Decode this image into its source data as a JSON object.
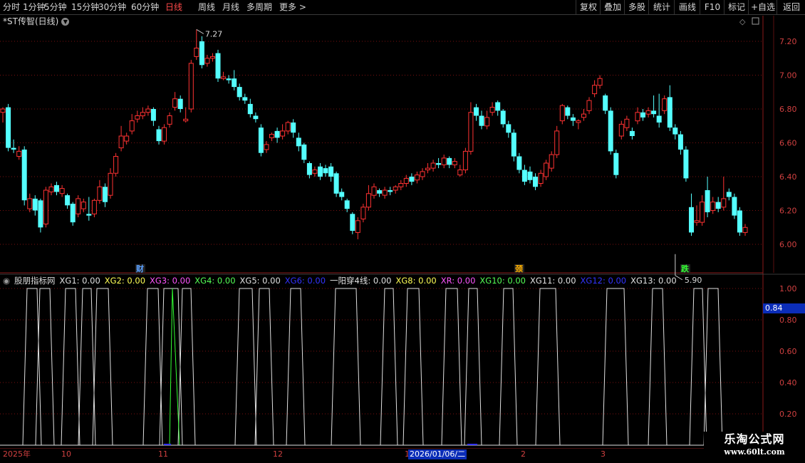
{
  "toolbar": {
    "periods": [
      "分时",
      "1分钟",
      "5分钟",
      "15分钟",
      "30分钟",
      "60分钟",
      "日线",
      "周线",
      "月线",
      "多周期",
      "更多 >"
    ],
    "active_period": "日线",
    "right_buttons": [
      "复权",
      "叠加",
      "多股",
      "统计",
      "画线",
      "F10",
      "标记",
      "+自选",
      "返回"
    ]
  },
  "chart": {
    "title": "*ST传智(日线)",
    "y_ticks": [
      "7.20",
      "7.00",
      "6.80",
      "6.60",
      "6.40",
      "6.20",
      "6.00"
    ],
    "high_label": "7.27",
    "low_label": "5.90",
    "events": [
      {
        "text": "财",
        "color": "#5aa0ff"
      },
      {
        "text": "颈",
        "color": "#ffb000"
      },
      {
        "text": "跌",
        "color": "#33ff33"
      }
    ]
  },
  "indicator": {
    "name": "股朋指标网",
    "lines": [
      {
        "text": "XG1: 0.00",
        "color": "#e0e0e0"
      },
      {
        "text": "XG2: 0.00",
        "color": "#ffff55"
      },
      {
        "text": "XG3: 0.00",
        "color": "#ff55ff"
      },
      {
        "text": "XG4: 0.00",
        "color": "#55ff55"
      },
      {
        "text": "XG5: 0.00",
        "color": "#e0e0e0"
      },
      {
        "text": "XG6: 0.00",
        "color": "#3333ff"
      },
      {
        "text": "一阳穿4线: 0.00",
        "color": "#e0e0e0"
      },
      {
        "text": "XG8: 0.00",
        "color": "#ffff55"
      },
      {
        "text": "XR: 0.00",
        "color": "#ff55ff"
      },
      {
        "text": "XG10: 0.00",
        "color": "#55ff55"
      },
      {
        "text": "XG11: 0.00",
        "color": "#e0e0e0"
      },
      {
        "text": "XG12: 0.00",
        "color": "#3333ff"
      },
      {
        "text": "XG13: 0.00",
        "color": "#e0e0e0"
      }
    ],
    "y_ticks": [
      "1.00",
      "0.80",
      "0.60",
      "0.40",
      "0.20"
    ],
    "cursor_value": "0.84"
  },
  "time_axis": {
    "labels": [
      "2025年",
      "10",
      "11",
      "12",
      "1",
      "2",
      "3"
    ],
    "selected_date": "2026/01/06/二"
  },
  "watermark": {
    "line1": "乐淘公式网",
    "line2": "www.60lt.com"
  },
  "colors": {
    "up": "#ff3232",
    "down": "#54ffff",
    "grid": "#7a1010",
    "axis_text": "#d04040",
    "active": "#ff4a4a"
  },
  "chart_data": {
    "type": "candlestick",
    "ylim": [
      5.82,
      7.35
    ],
    "candles": [
      [
        6.78,
        6.8,
        6.72,
        6.81
      ],
      [
        6.81,
        6.57,
        6.55,
        6.83
      ],
      [
        6.57,
        6.56,
        6.54,
        6.62
      ],
      [
        6.52,
        6.55,
        6.5,
        6.58
      ],
      [
        6.56,
        6.26,
        6.23,
        6.58
      ],
      [
        6.21,
        6.27,
        6.19,
        6.3
      ],
      [
        6.27,
        6.2,
        6.17,
        6.29
      ],
      [
        6.26,
        6.1,
        6.07,
        6.27
      ],
      [
        6.12,
        6.32,
        6.1,
        6.34
      ],
      [
        6.31,
        6.34,
        6.29,
        6.36
      ],
      [
        6.35,
        6.31,
        6.29,
        6.37
      ],
      [
        6.3,
        6.33,
        6.28,
        6.35
      ],
      [
        6.29,
        6.23,
        6.21,
        6.3
      ],
      [
        6.24,
        6.13,
        6.11,
        6.25
      ],
      [
        6.18,
        6.27,
        6.16,
        6.29
      ],
      [
        6.21,
        6.25,
        6.19,
        6.27
      ],
      [
        6.18,
        6.17,
        6.14,
        6.28
      ],
      [
        6.18,
        6.26,
        6.16,
        6.27
      ],
      [
        6.26,
        6.34,
        6.24,
        6.38
      ],
      [
        6.34,
        6.25,
        6.22,
        6.36
      ],
      [
        6.29,
        6.42,
        6.27,
        6.45
      ],
      [
        6.42,
        6.52,
        6.4,
        6.54
      ],
      [
        6.57,
        6.64,
        6.55,
        6.7
      ],
      [
        6.61,
        6.64,
        6.59,
        6.66
      ],
      [
        6.67,
        6.73,
        6.65,
        6.77
      ],
      [
        6.74,
        6.76,
        6.72,
        6.79
      ],
      [
        6.76,
        6.78,
        6.74,
        6.81
      ],
      [
        6.78,
        6.8,
        6.76,
        6.82
      ],
      [
        6.8,
        6.73,
        6.7,
        6.81
      ],
      [
        6.68,
        6.61,
        6.59,
        6.7
      ],
      [
        6.61,
        6.69,
        6.59,
        6.71
      ],
      [
        6.71,
        6.76,
        6.69,
        6.78
      ],
      [
        6.81,
        6.86,
        6.79,
        6.9
      ],
      [
        6.86,
        6.8,
        6.78,
        6.88
      ],
      [
        6.73,
        6.74,
        6.72,
        6.81
      ],
      [
        6.8,
        7.07,
        6.78,
        7.09
      ],
      [
        7.11,
        7.16,
        7.09,
        7.27
      ],
      [
        7.2,
        7.06,
        7.04,
        7.23
      ],
      [
        7.07,
        7.1,
        7.05,
        7.12
      ],
      [
        7.1,
        7.11,
        7.08,
        7.13
      ],
      [
        7.13,
        6.98,
        6.96,
        7.15
      ],
      [
        6.98,
        6.99,
        6.97,
        7.02
      ],
      [
        6.98,
        6.97,
        6.95,
        7.0
      ],
      [
        6.98,
        6.93,
        6.91,
        7.03
      ],
      [
        6.93,
        6.87,
        6.85,
        6.95
      ],
      [
        6.87,
        6.85,
        6.83,
        6.89
      ],
      [
        6.83,
        6.77,
        6.75,
        6.86
      ],
      [
        6.76,
        6.74,
        6.72,
        6.78
      ],
      [
        6.69,
        6.54,
        6.52,
        6.71
      ],
      [
        6.56,
        6.59,
        6.54,
        6.61
      ],
      [
        6.63,
        6.65,
        6.61,
        6.66
      ],
      [
        6.67,
        6.63,
        6.6,
        6.69
      ],
      [
        6.64,
        6.67,
        6.62,
        6.71
      ],
      [
        6.67,
        6.72,
        6.65,
        6.73
      ],
      [
        6.72,
        6.66,
        6.63,
        6.74
      ],
      [
        6.63,
        6.58,
        6.55,
        6.66
      ],
      [
        6.59,
        6.5,
        6.48,
        6.6
      ],
      [
        6.48,
        6.41,
        6.39,
        6.49
      ],
      [
        6.42,
        6.44,
        6.4,
        6.46
      ],
      [
        6.46,
        6.4,
        6.38,
        6.48
      ],
      [
        6.45,
        6.42,
        6.4,
        6.47
      ],
      [
        6.46,
        6.4,
        6.37,
        6.48
      ],
      [
        6.42,
        6.3,
        6.28,
        6.43
      ],
      [
        6.31,
        6.28,
        6.26,
        6.33
      ],
      [
        6.26,
        6.21,
        6.19,
        6.27
      ],
      [
        6.18,
        6.08,
        6.06,
        6.19
      ],
      [
        6.07,
        6.14,
        6.03,
        6.16
      ],
      [
        6.15,
        6.22,
        6.13,
        6.24
      ],
      [
        6.22,
        6.3,
        6.2,
        6.35
      ],
      [
        6.29,
        6.34,
        6.27,
        6.36
      ],
      [
        6.32,
        6.3,
        6.28,
        6.33
      ],
      [
        6.29,
        6.32,
        6.27,
        6.34
      ],
      [
        6.32,
        6.31,
        6.29,
        6.34
      ],
      [
        6.32,
        6.34,
        6.3,
        6.35
      ],
      [
        6.34,
        6.36,
        6.32,
        6.38
      ],
      [
        6.36,
        6.39,
        6.34,
        6.41
      ],
      [
        6.4,
        6.37,
        6.35,
        6.42
      ],
      [
        6.38,
        6.41,
        6.36,
        6.43
      ],
      [
        6.4,
        6.43,
        6.38,
        6.45
      ],
      [
        6.44,
        6.45,
        6.42,
        6.48
      ],
      [
        6.45,
        6.48,
        6.43,
        6.5
      ],
      [
        6.48,
        6.47,
        6.45,
        6.51
      ],
      [
        6.47,
        6.51,
        6.45,
        6.53
      ],
      [
        6.51,
        6.47,
        6.45,
        6.52
      ],
      [
        6.47,
        6.49,
        6.45,
        6.51
      ],
      [
        6.41,
        6.44,
        6.4,
        6.47
      ],
      [
        6.44,
        6.55,
        6.42,
        6.57
      ],
      [
        6.55,
        6.78,
        6.53,
        6.84
      ],
      [
        6.81,
        6.76,
        6.73,
        6.83
      ],
      [
        6.76,
        6.7,
        6.68,
        6.79
      ],
      [
        6.7,
        6.75,
        6.68,
        6.79
      ],
      [
        6.78,
        6.81,
        6.76,
        6.84
      ],
      [
        6.84,
        6.79,
        6.76,
        6.85
      ],
      [
        6.79,
        6.71,
        6.69,
        6.8
      ],
      [
        6.71,
        6.66,
        6.63,
        6.73
      ],
      [
        6.66,
        6.52,
        6.49,
        6.68
      ],
      [
        6.52,
        6.44,
        6.42,
        6.54
      ],
      [
        6.44,
        6.37,
        6.35,
        6.47
      ],
      [
        6.43,
        6.38,
        6.36,
        6.46
      ],
      [
        6.4,
        6.34,
        6.32,
        6.42
      ],
      [
        6.36,
        6.42,
        6.34,
        6.44
      ],
      [
        6.4,
        6.48,
        6.38,
        6.5
      ],
      [
        6.45,
        6.53,
        6.43,
        6.55
      ],
      [
        6.53,
        6.67,
        6.51,
        6.7
      ],
      [
        6.73,
        6.82,
        6.71,
        6.83
      ],
      [
        6.81,
        6.76,
        6.74,
        6.82
      ],
      [
        6.75,
        6.73,
        6.7,
        6.77
      ],
      [
        6.72,
        6.73,
        6.68,
        6.74
      ],
      [
        6.75,
        6.77,
        6.73,
        6.8
      ],
      [
        6.79,
        6.85,
        6.77,
        6.87
      ],
      [
        6.89,
        6.94,
        6.87,
        6.97
      ],
      [
        6.94,
        6.98,
        6.92,
        7.0
      ],
      [
        6.88,
        6.79,
        6.77,
        6.89
      ],
      [
        6.79,
        6.55,
        6.53,
        6.81
      ],
      [
        6.54,
        6.41,
        6.39,
        6.56
      ],
      [
        6.64,
        6.71,
        6.62,
        6.73
      ],
      [
        6.69,
        6.74,
        6.67,
        6.76
      ],
      [
        6.67,
        6.64,
        6.62,
        6.69
      ],
      [
        6.73,
        6.78,
        6.71,
        6.81
      ],
      [
        6.78,
        6.75,
        6.73,
        6.8
      ],
      [
        6.77,
        6.79,
        6.75,
        6.81
      ],
      [
        6.79,
        6.77,
        6.75,
        6.88
      ],
      [
        6.76,
        6.72,
        6.69,
        6.89
      ],
      [
        6.79,
        6.86,
        6.77,
        6.88
      ],
      [
        6.87,
        6.69,
        6.67,
        6.94
      ],
      [
        6.69,
        6.65,
        6.62,
        6.71
      ],
      [
        6.65,
        6.56,
        6.53,
        6.67
      ],
      [
        6.56,
        6.39,
        6.37,
        6.58
      ],
      [
        6.22,
        6.07,
        6.05,
        6.3
      ],
      [
        6.13,
        6.14,
        6.11,
        6.23
      ],
      [
        6.13,
        6.25,
        6.11,
        6.29
      ],
      [
        6.32,
        6.19,
        6.16,
        6.4
      ],
      [
        6.2,
        6.25,
        6.18,
        6.28
      ],
      [
        6.25,
        6.21,
        6.19,
        6.28
      ],
      [
        6.22,
        6.27,
        6.2,
        6.4
      ],
      [
        6.31,
        6.28,
        6.26,
        6.33
      ],
      [
        6.28,
        6.17,
        6.15,
        6.3
      ],
      [
        6.2,
        6.07,
        6.05,
        6.22
      ],
      [
        6.07,
        6.1,
        6.05,
        6.12
      ]
    ]
  }
}
